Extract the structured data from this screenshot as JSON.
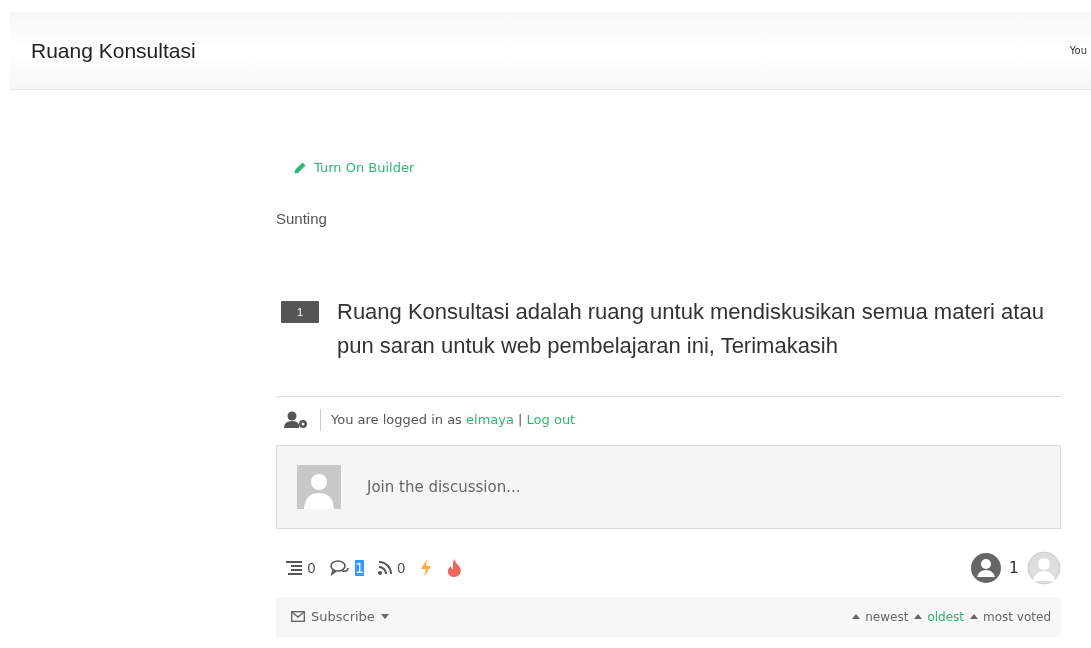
{
  "header": {
    "title": "Ruang Konsultasi",
    "right_text": "You"
  },
  "builder_link": "Turn On Builder",
  "edit_label": "Sunting",
  "notice": {
    "number": "1",
    "text": "Ruang Konsultasi adalah ruang untuk mendiskusikan semua materi atau pun saran untuk web pembelajaran ini, Terimakasih"
  },
  "login": {
    "prefix": "You are logged in as",
    "user": "elmaya",
    "separator": "|",
    "logout": "Log out"
  },
  "comment_box": {
    "placeholder": "Join the discussion..."
  },
  "stats": [
    {
      "kind": "threads",
      "value": "0",
      "highlighted": false
    },
    {
      "kind": "replies",
      "value": "1",
      "highlighted": true
    },
    {
      "kind": "feed",
      "value": "0",
      "highlighted": false
    },
    {
      "kind": "hot"
    },
    {
      "kind": "trending"
    }
  ],
  "participants": {
    "count": "1"
  },
  "subscribe": "Subscribe",
  "sort": [
    {
      "label": "newest",
      "selected": false
    },
    {
      "label": "oldest",
      "selected": true
    },
    {
      "label": "most voted",
      "selected": false
    }
  ]
}
